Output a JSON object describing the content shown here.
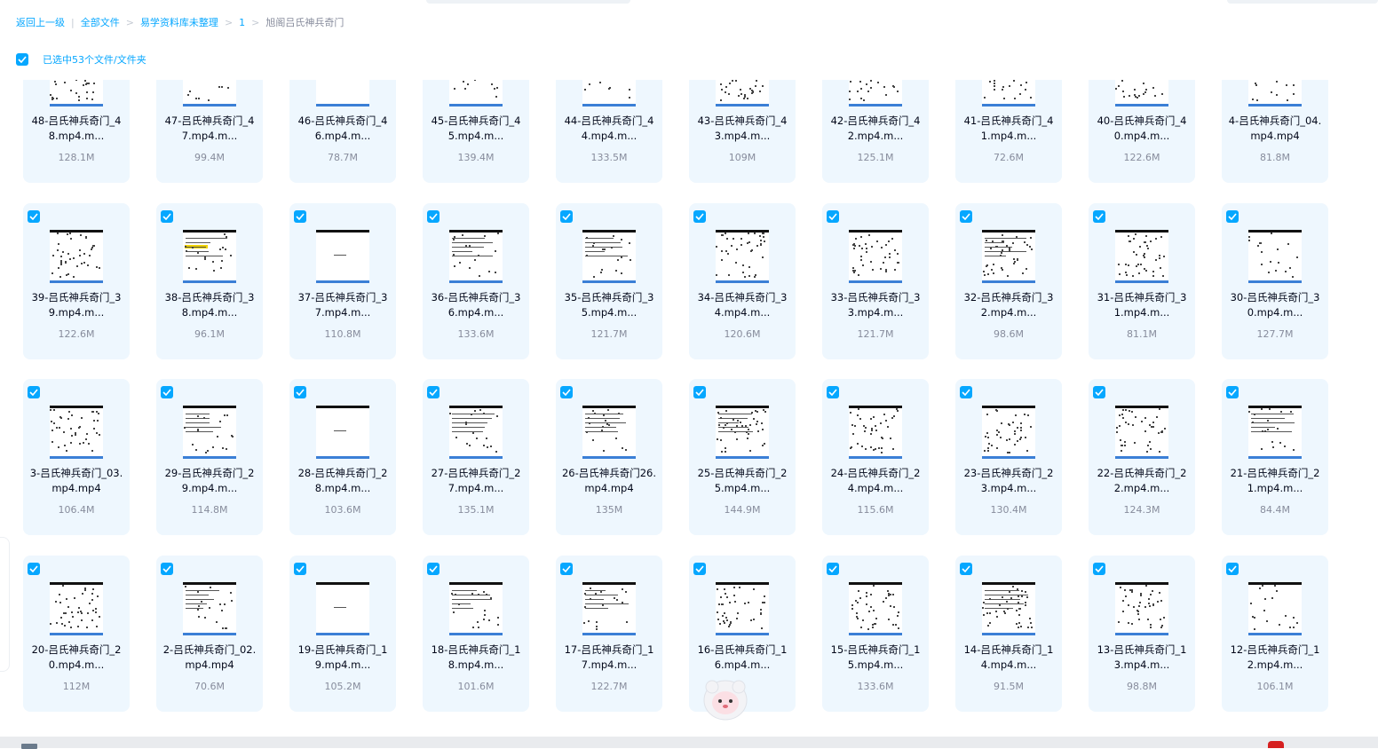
{
  "breadcrumb": {
    "items": [
      "返回上一级",
      "全部文件",
      "易学资料库未整理",
      "1",
      "旭阁吕氏神兵奇门"
    ]
  },
  "selection": {
    "label": "已选中53个文件/文件夹",
    "checked": true
  },
  "colors": {
    "accent": "#06a7ff",
    "card_bg": "#eef7fe",
    "name_text": "#03081a",
    "size_text": "#878c9c"
  },
  "file_icon": "video-thumbnail",
  "files": [
    {
      "name": "48-吕氏神兵奇门_48.mp4.m...",
      "size": "128.1M",
      "checked": true
    },
    {
      "name": "47-吕氏神兵奇门_47.mp4.m...",
      "size": "99.4M",
      "checked": true
    },
    {
      "name": "46-吕氏神兵奇门_46.mp4.m...",
      "size": "78.7M",
      "checked": true
    },
    {
      "name": "45-吕氏神兵奇门_45.mp4.m...",
      "size": "139.4M",
      "checked": true
    },
    {
      "name": "44-吕氏神兵奇门_44.mp4.m...",
      "size": "133.5M",
      "checked": true
    },
    {
      "name": "43-吕氏神兵奇门_43.mp4.m...",
      "size": "109M",
      "checked": true
    },
    {
      "name": "42-吕氏神兵奇门_42.mp4.m...",
      "size": "125.1M",
      "checked": true
    },
    {
      "name": "41-吕氏神兵奇门_41.mp4.m...",
      "size": "72.6M",
      "checked": true
    },
    {
      "name": "40-吕氏神兵奇门_40.mp4.m...",
      "size": "122.6M",
      "checked": true
    },
    {
      "name": "4-吕氏神兵奇门_04.mp4.mp4",
      "size": "81.8M",
      "checked": true
    },
    {
      "name": "39-吕氏神兵奇门_39.mp4.m...",
      "size": "122.6M",
      "checked": true
    },
    {
      "name": "38-吕氏神兵奇门_38.mp4.m...",
      "size": "96.1M",
      "checked": true
    },
    {
      "name": "37-吕氏神兵奇门_37.mp4.m...",
      "size": "110.8M",
      "checked": true
    },
    {
      "name": "36-吕氏神兵奇门_36.mp4.m...",
      "size": "133.6M",
      "checked": true
    },
    {
      "name": "35-吕氏神兵奇门_35.mp4.m...",
      "size": "121.7M",
      "checked": true
    },
    {
      "name": "34-吕氏神兵奇门_34.mp4.m...",
      "size": "120.6M",
      "checked": true
    },
    {
      "name": "33-吕氏神兵奇门_33.mp4.m...",
      "size": "121.7M",
      "checked": true
    },
    {
      "name": "32-吕氏神兵奇门_32.mp4.m...",
      "size": "98.6M",
      "checked": true
    },
    {
      "name": "31-吕氏神兵奇门_31.mp4.m...",
      "size": "81.1M",
      "checked": true
    },
    {
      "name": "30-吕氏神兵奇门_30.mp4.m...",
      "size": "127.7M",
      "checked": true
    },
    {
      "name": "3-吕氏神兵奇门_03.mp4.mp4",
      "size": "106.4M",
      "checked": true
    },
    {
      "name": "29-吕氏神兵奇门_29.mp4.m...",
      "size": "114.8M",
      "checked": true
    },
    {
      "name": "28-吕氏神兵奇门_28.mp4.m...",
      "size": "103.6M",
      "checked": true
    },
    {
      "name": "27-吕氏神兵奇门_27.mp4.m...",
      "size": "135.1M",
      "checked": true
    },
    {
      "name": "26-吕氏神兵奇门26.mp4.mp4",
      "size": "135M",
      "checked": true
    },
    {
      "name": "25-吕氏神兵奇门_25.mp4.m...",
      "size": "144.9M",
      "checked": true
    },
    {
      "name": "24-吕氏神兵奇门_24.mp4.m...",
      "size": "115.6M",
      "checked": true
    },
    {
      "name": "23-吕氏神兵奇门_23.mp4.m...",
      "size": "130.4M",
      "checked": true
    },
    {
      "name": "22-吕氏神兵奇门_22.mp4.m...",
      "size": "124.3M",
      "checked": true
    },
    {
      "name": "21-吕氏神兵奇门_21.mp4.m...",
      "size": "84.4M",
      "checked": true
    },
    {
      "name": "20-吕氏神兵奇门_20.mp4.m...",
      "size": "112M",
      "checked": true
    },
    {
      "name": "2-吕氏神兵奇门_02.mp4.mp4",
      "size": "70.6M",
      "checked": true
    },
    {
      "name": "19-吕氏神兵奇门_19.mp4.m...",
      "size": "105.2M",
      "checked": true
    },
    {
      "name": "18-吕氏神兵奇门_18.mp4.m...",
      "size": "101.6M",
      "checked": true
    },
    {
      "name": "17-吕氏神兵奇门_17.mp4.m...",
      "size": "122.7M",
      "checked": true
    },
    {
      "name": "16-吕氏神兵奇门_16.mp4.m...",
      "size": "",
      "checked": true
    },
    {
      "name": "15-吕氏神兵奇门_15.mp4.m...",
      "size": "133.6M",
      "checked": true
    },
    {
      "name": "14-吕氏神兵奇门_14.mp4.m...",
      "size": "91.5M",
      "checked": true
    },
    {
      "name": "13-吕氏神兵奇门_13.mp4.m...",
      "size": "98.8M",
      "checked": true
    },
    {
      "name": "12-吕氏神兵奇门_12.mp4.m...",
      "size": "106.1M",
      "checked": true
    }
  ]
}
